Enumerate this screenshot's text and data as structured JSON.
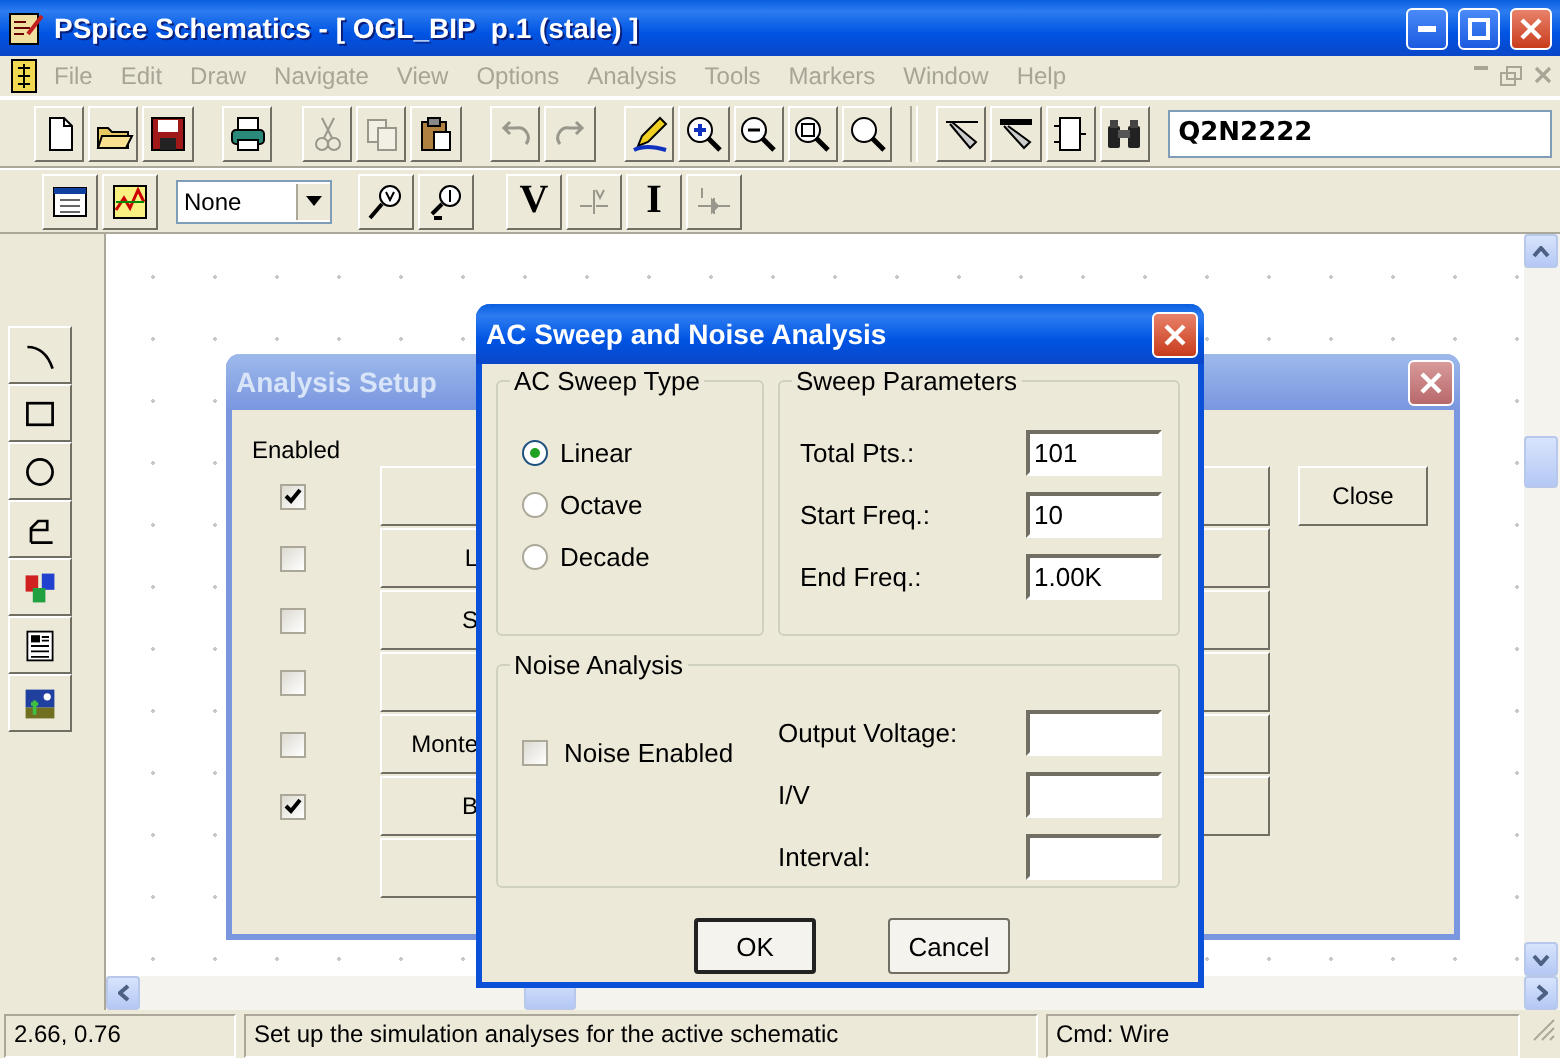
{
  "window": {
    "title": "PSpice Schematics - [ OGL_BIP  p.1 (stale) ]"
  },
  "menu": [
    {
      "label": "File",
      "disabled": true
    },
    {
      "label": "Edit",
      "disabled": true
    },
    {
      "label": "Draw",
      "disabled": true
    },
    {
      "label": "Navigate",
      "disabled": true
    },
    {
      "label": "View",
      "disabled": true
    },
    {
      "label": "Options",
      "disabled": true
    },
    {
      "label": "Analysis",
      "disabled": true
    },
    {
      "label": "Tools",
      "disabled": true
    },
    {
      "label": "Markers",
      "disabled": true
    },
    {
      "label": "Window",
      "disabled": true
    },
    {
      "label": "Help",
      "disabled": true
    }
  ],
  "toolbar": {
    "buttons": [
      {
        "kind": "new",
        "disabled": false
      },
      {
        "kind": "open",
        "disabled": false
      },
      {
        "kind": "save",
        "disabled": false
      },
      {
        "kind": "gap"
      },
      {
        "kind": "print",
        "disabled": false
      },
      {
        "kind": "gap"
      },
      {
        "kind": "cut",
        "disabled": true
      },
      {
        "kind": "copy",
        "disabled": true
      },
      {
        "kind": "paste",
        "disabled": false
      },
      {
        "kind": "gap"
      },
      {
        "kind": "undo",
        "disabled": true
      },
      {
        "kind": "redo",
        "disabled": true
      },
      {
        "kind": "gap"
      },
      {
        "kind": "redraw",
        "disabled": false
      },
      {
        "kind": "zoom-in",
        "disabled": false
      },
      {
        "kind": "zoom-out",
        "disabled": false
      },
      {
        "kind": "zoom-area",
        "disabled": false
      },
      {
        "kind": "zoom-fit",
        "disabled": false
      },
      {
        "kind": "sep"
      },
      {
        "kind": "wire",
        "disabled": false
      },
      {
        "kind": "bus",
        "disabled": false
      },
      {
        "kind": "block",
        "disabled": false
      },
      {
        "kind": "get-part",
        "disabled": false
      }
    ],
    "part_field": {
      "value": "Q2N2222"
    }
  },
  "toolbar2": {
    "buttons": [
      {
        "kind": "setup",
        "disabled": false
      },
      {
        "kind": "probe",
        "disabled": false
      },
      {
        "kind": "combo"
      },
      {
        "kind": "v-marker",
        "disabled": false
      },
      {
        "kind": "i-marker",
        "disabled": false
      },
      {
        "kind": "gap"
      },
      {
        "kind": "glyph",
        "glyph": "V",
        "disabled": false
      },
      {
        "kind": "v-diff",
        "disabled": true
      },
      {
        "kind": "glyph",
        "glyph": "I",
        "disabled": false
      },
      {
        "kind": "i-pin",
        "disabled": true
      }
    ],
    "marker_combo": {
      "value": "None"
    }
  },
  "palette": [
    {
      "kind": "arc"
    },
    {
      "kind": "box"
    },
    {
      "kind": "circle"
    },
    {
      "kind": "polyline"
    },
    {
      "kind": "text"
    },
    {
      "kind": "text-box"
    },
    {
      "kind": "picture"
    }
  ],
  "analysis_setup": {
    "title": "Analysis Setup",
    "enabled_header": "Enabled",
    "rows": [
      {
        "checked": true
      },
      {
        "checked": false,
        "label": "L"
      },
      {
        "checked": false,
        "label": "S"
      },
      {
        "checked": false
      },
      {
        "checked": false,
        "label": "Monte"
      },
      {
        "checked": true,
        "label": "B"
      }
    ],
    "close_button": "Close"
  },
  "ac_dialog": {
    "title": "AC Sweep and Noise Analysis",
    "sweep_type": {
      "legend": "AC Sweep Type",
      "options": [
        {
          "label": "Linear",
          "selected": true
        },
        {
          "label": "Octave",
          "selected": false
        },
        {
          "label": "Decade",
          "selected": false
        }
      ]
    },
    "sweep_parameters": {
      "legend": "Sweep Parameters",
      "fields": [
        {
          "label": "Total Pts.:",
          "value": "101"
        },
        {
          "label": "Start Freq.:",
          "value": "10"
        },
        {
          "label": "End Freq.:",
          "value": "1.00K"
        }
      ]
    },
    "noise": {
      "legend": "Noise Analysis",
      "noise_enabled": {
        "label": "Noise Enabled",
        "checked": false
      },
      "fields": [
        {
          "label": "Output Voltage:"
        },
        {
          "label": "I/V"
        },
        {
          "label": "Interval:"
        }
      ]
    },
    "buttons": [
      {
        "label": "OK",
        "default": true
      },
      {
        "label": "Cancel",
        "default": false
      }
    ]
  },
  "status_bar": {
    "coordinates": "2.66, 0.76",
    "message": "Set up the simulation analyses for the active schematic",
    "command": "Cmd: Wire"
  }
}
